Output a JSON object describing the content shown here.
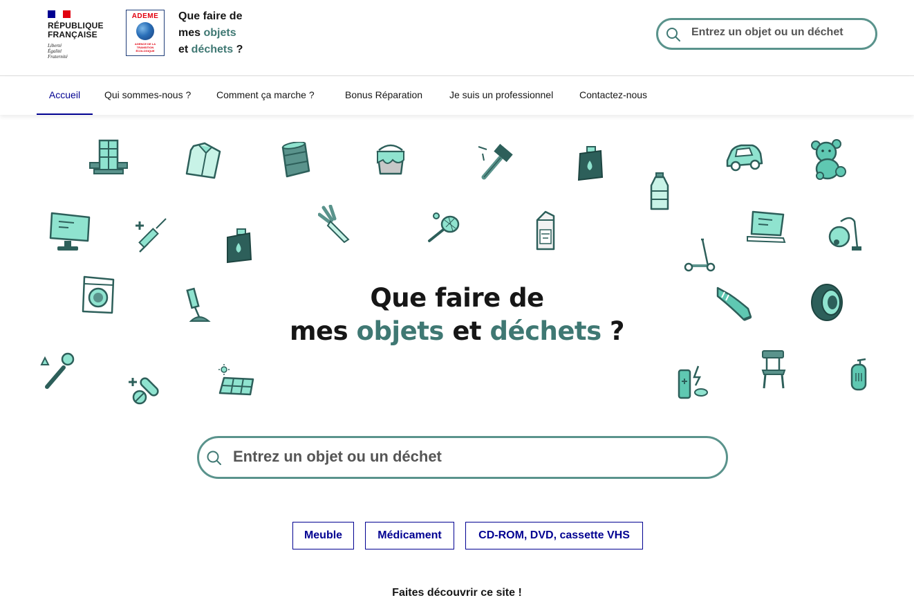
{
  "header": {
    "gov_name_line1": "RÉPUBLIQUE",
    "gov_name_line2": "FRANÇAISE",
    "gov_motto_1": "Liberté",
    "gov_motto_2": "Égalité",
    "gov_motto_3": "Fraternité",
    "ademe_logo_text": "ADEME",
    "ademe_subtitle": "AGENCE DE LA TRANSITION ÉCOLOGIQUE",
    "site_title_1": "Que faire de",
    "site_title_2a": "mes ",
    "site_title_2b": "objets",
    "site_title_3a": "et ",
    "site_title_3b": "déchets",
    "site_title_3c": " ?",
    "search_placeholder": "Entrez un objet ou un déchet"
  },
  "nav": {
    "items": [
      {
        "label": "Accueil",
        "active": true
      },
      {
        "label": "Qui sommes-nous ?"
      },
      {
        "label": "Comment ça marche ?"
      },
      {
        "label": "Bonus Réparation"
      },
      {
        "label": "Je suis un professionnel"
      },
      {
        "label": "Contactez-nous"
      }
    ]
  },
  "hero": {
    "title_line1": "Que faire de",
    "title_l2_a": "mes ",
    "title_l2_b": "objets",
    "title_l2_c": " et ",
    "title_l2_d": "déchets",
    "title_l2_e": " ?",
    "search_placeholder": "Entrez un objet ou un déchet",
    "suggestions": [
      "Meuble",
      "Médicament",
      "CD-ROM, DVD, cassette VHS"
    ]
  },
  "share_text": "Faites découvrir ce site !",
  "colors": {
    "accent": "#3f7873",
    "icon_fill": "#8fe3cf",
    "icon_dark": "#2d5f5a",
    "dsfr_blue": "#000091",
    "flag_red": "#e1000f"
  },
  "decor_icons": [
    "building-icon",
    "shirt-icon",
    "barrel-icon",
    "paint-bucket-icon",
    "hammer-icon",
    "oil-can-icon",
    "car-icon",
    "teddy-bear-icon",
    "water-bottle-icon",
    "monitor-icon",
    "syringe-icon",
    "jerrycan-icon",
    "leek-icon",
    "tennis-racket-icon",
    "milk-carton-icon",
    "laptop-icon",
    "vacuum-cleaner-icon",
    "scooter-icon",
    "washing-machine-icon",
    "lamp-icon",
    "sneaker-icon",
    "tire-icon",
    "flashlight-icon",
    "pills-icon",
    "solar-panel-icon",
    "battery-icon",
    "chair-icon",
    "fire-extinguisher-icon"
  ]
}
